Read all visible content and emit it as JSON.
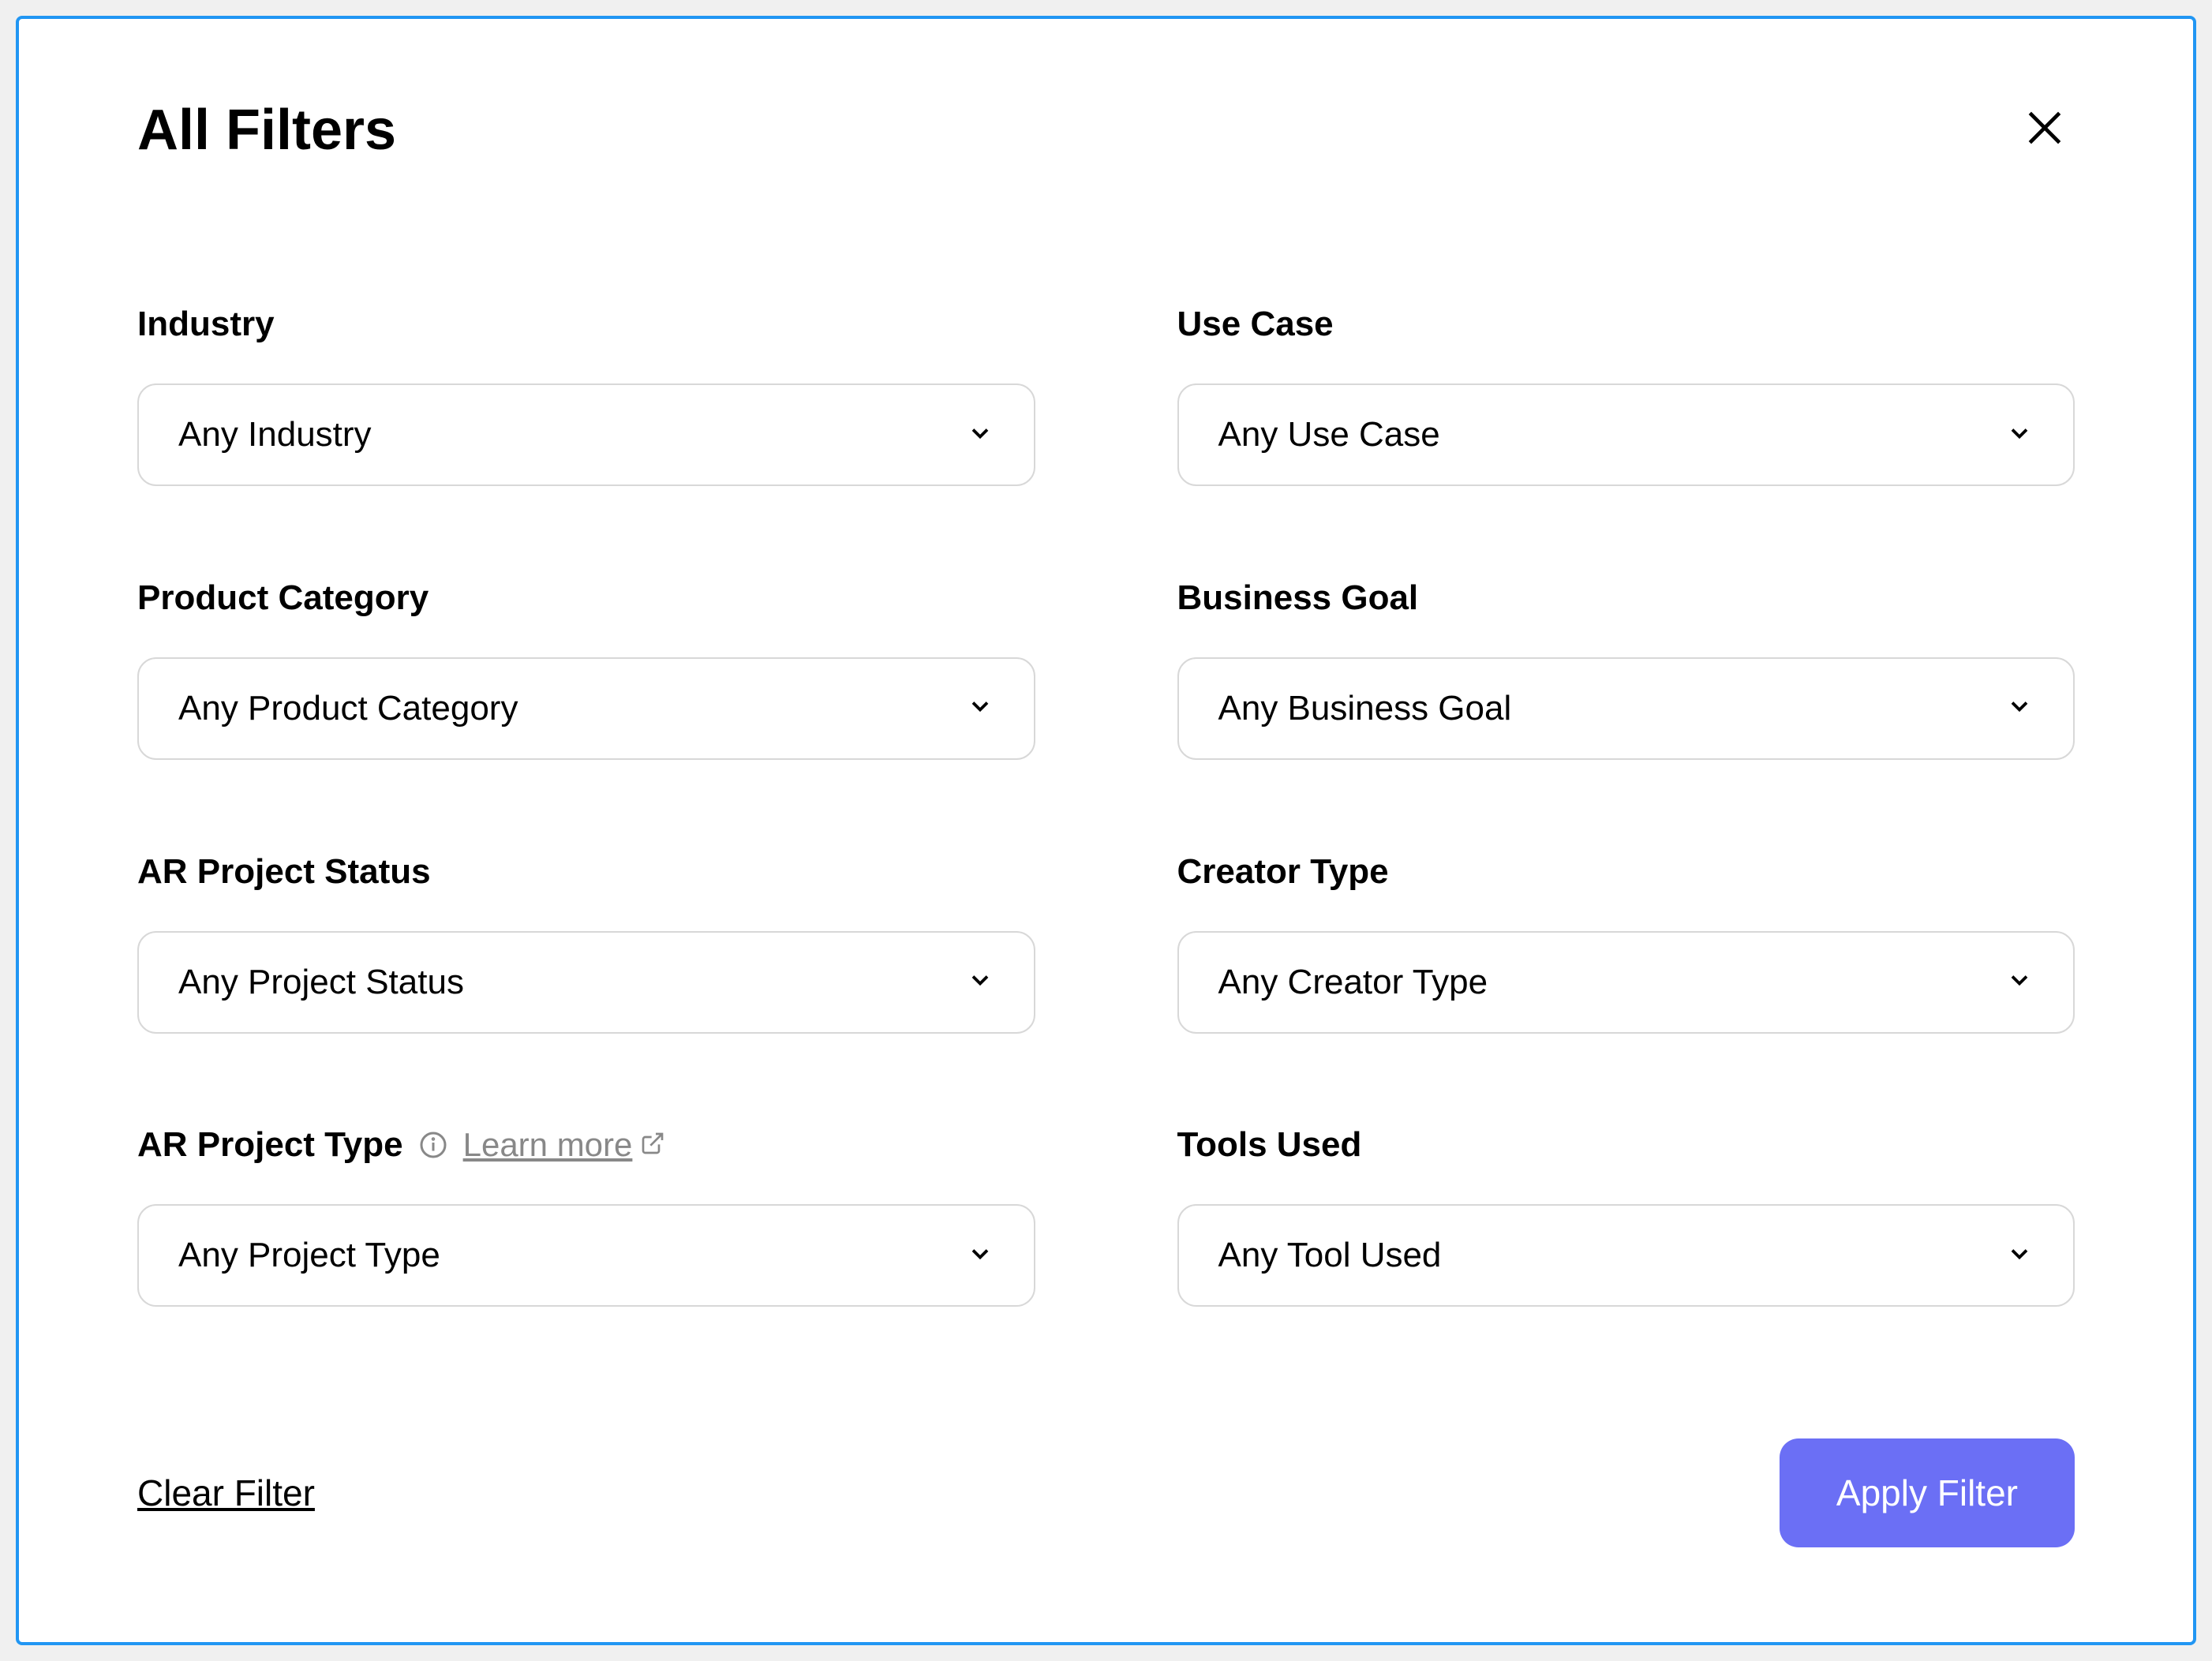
{
  "modal": {
    "title": "All Filters"
  },
  "filters": {
    "industry": {
      "label": "Industry",
      "value": "Any Industry"
    },
    "use_case": {
      "label": "Use Case",
      "value": "Any Use Case"
    },
    "product_category": {
      "label": "Product Category",
      "value": "Any Product Category"
    },
    "business_goal": {
      "label": "Business Goal",
      "value": "Any Business Goal"
    },
    "ar_project_status": {
      "label": "AR Project Status",
      "value": "Any Project Status"
    },
    "creator_type": {
      "label": "Creator Type",
      "value": "Any Creator Type"
    },
    "ar_project_type": {
      "label": "AR Project Type",
      "learn_more": "Learn more",
      "value": "Any Project Type"
    },
    "tools_used": {
      "label": "Tools Used",
      "value": "Any Tool Used"
    }
  },
  "actions": {
    "clear": "Clear Filter",
    "apply": "Apply Filter"
  }
}
